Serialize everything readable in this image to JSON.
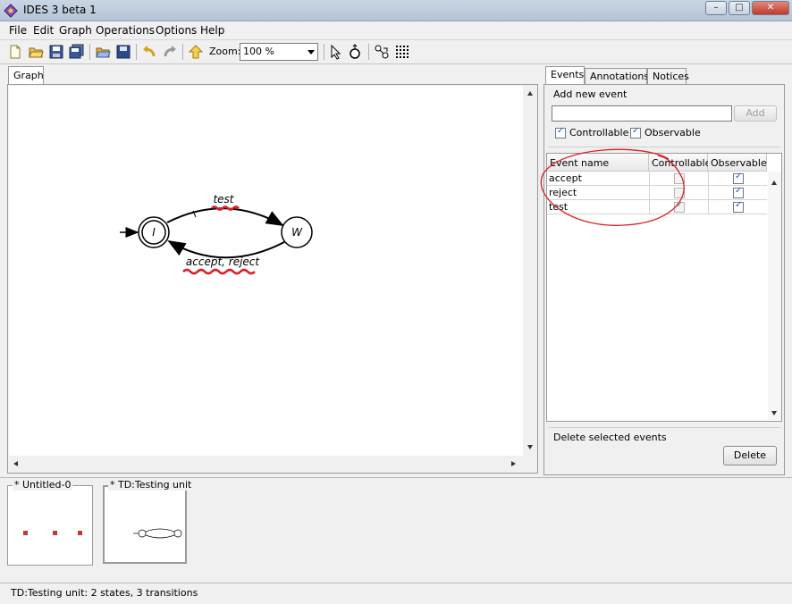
{
  "window": {
    "title": "IDES 3 beta 1",
    "minimize": "–",
    "maximize": "□",
    "close": "✕"
  },
  "menu": [
    "File",
    "Edit",
    "Graph",
    "Operations",
    "Options",
    "Help"
  ],
  "toolbar": {
    "zoom_label": "Zoom:",
    "zoom_value": "100 %"
  },
  "graph_tab": {
    "label": "Graph"
  },
  "graph": {
    "states": [
      {
        "label": "I",
        "initial": true,
        "marked": true
      },
      {
        "label": "W",
        "initial": false,
        "marked": false
      }
    ],
    "transitions": [
      {
        "from": "I",
        "to": "W",
        "label": "test"
      },
      {
        "from": "W",
        "to": "I",
        "label": "accept, reject"
      }
    ]
  },
  "right_panel": {
    "tabs": [
      "Events",
      "Annotations",
      "Notices"
    ],
    "add_event": {
      "group_title": "Add new event",
      "input_value": "",
      "add_button": "Add",
      "controllable_label": "Controllable",
      "controllable_checked": true,
      "observable_label": "Observable",
      "observable_checked": true
    },
    "table": {
      "headers": [
        "Event name",
        "Controllable",
        "Observable"
      ],
      "rows": [
        {
          "name": "accept",
          "controllable": false,
          "observable": true
        },
        {
          "name": "reject",
          "controllable": false,
          "observable": true
        },
        {
          "name": "test",
          "controllable": true,
          "observable": true
        }
      ]
    },
    "delete_group": {
      "group_title": "Delete selected events",
      "delete_button": "Delete"
    }
  },
  "thumbnails": [
    {
      "title": "* Untitled-0"
    },
    {
      "title": "* TD:Testing unit"
    }
  ],
  "status": {
    "text": "TD:Testing unit:  2 states,   3 transitions"
  },
  "colors": {
    "annotation_red": "#d81f26",
    "titlebar": "#b4c4d6",
    "checkmark": "#2b5aa8"
  }
}
